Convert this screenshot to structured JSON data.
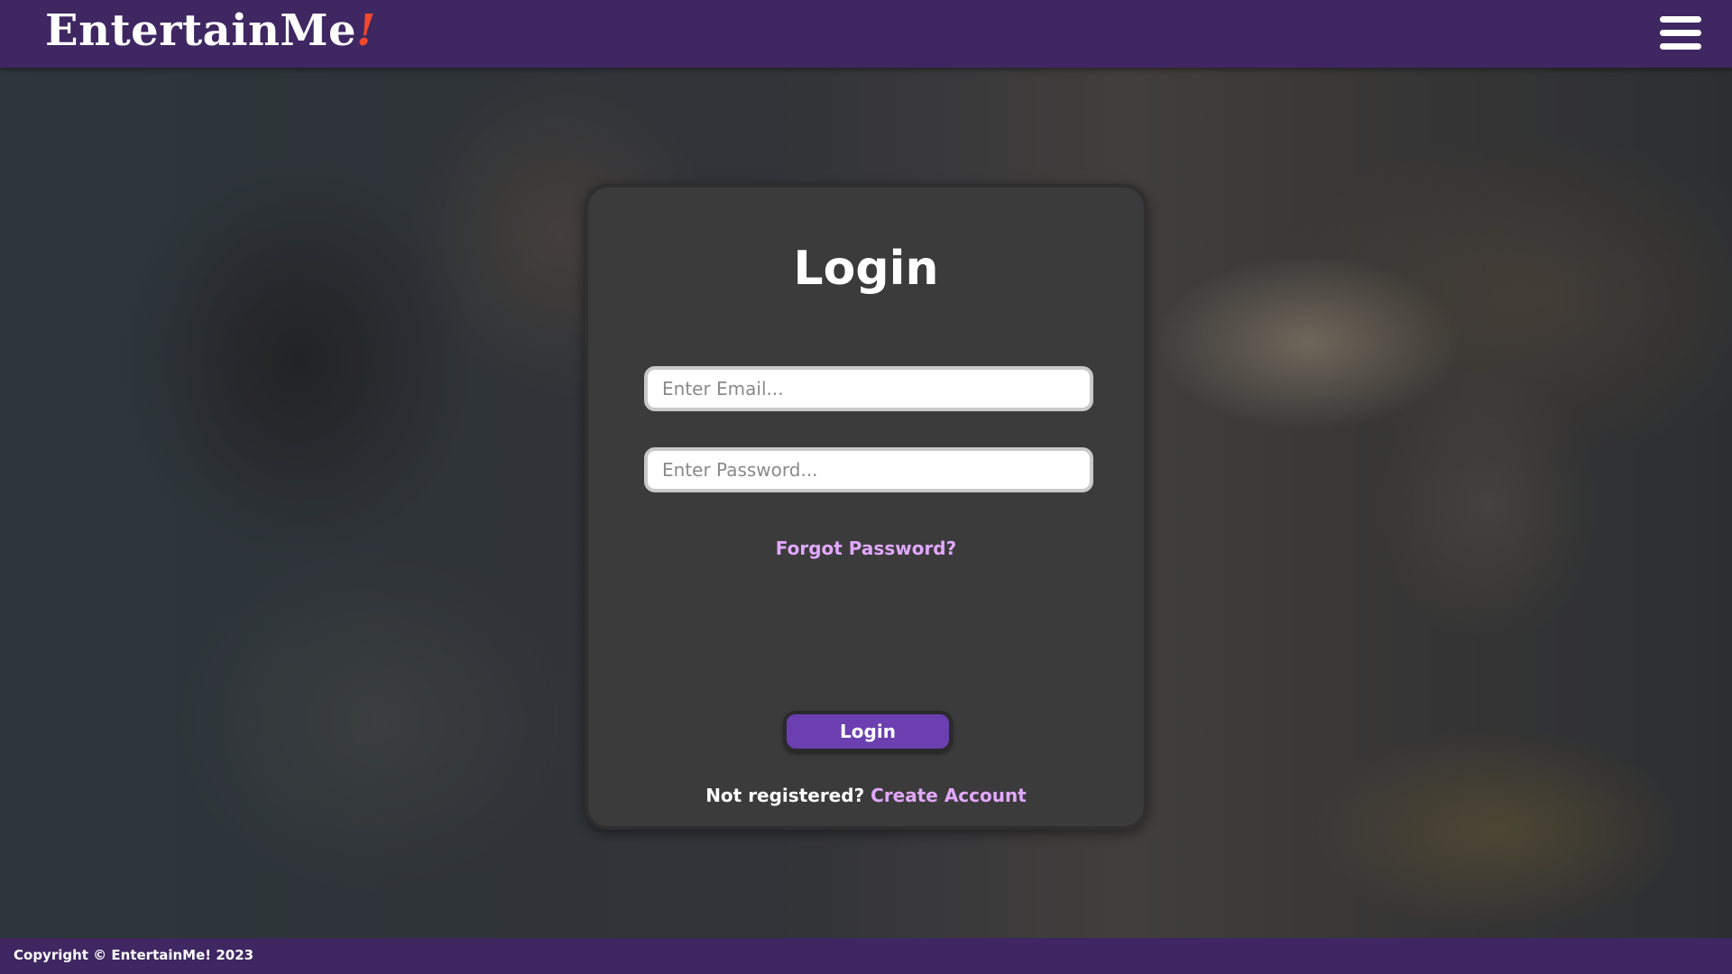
{
  "app": {
    "logo_text": "EntertainMe",
    "logo_mark": "!"
  },
  "header": {
    "menu_icon": "hamburger-menu-icon"
  },
  "login": {
    "title": "Login",
    "email_placeholder": "Enter Email...",
    "email_value": "",
    "password_placeholder": "Enter Password...",
    "password_value": "",
    "forgot_label": "Forgot Password?",
    "button_label": "Login",
    "register_prompt": "Not registered?",
    "register_link": "Create Account"
  },
  "footer": {
    "copyright": "Copyright © EntertainMe! 2023"
  },
  "colors": {
    "nav_bg": "#3f2762",
    "accent": "#6b3fb0",
    "link": "#e2a8ff",
    "logo_mark": "#f0492d",
    "card_bg": "#3b3b3c"
  }
}
